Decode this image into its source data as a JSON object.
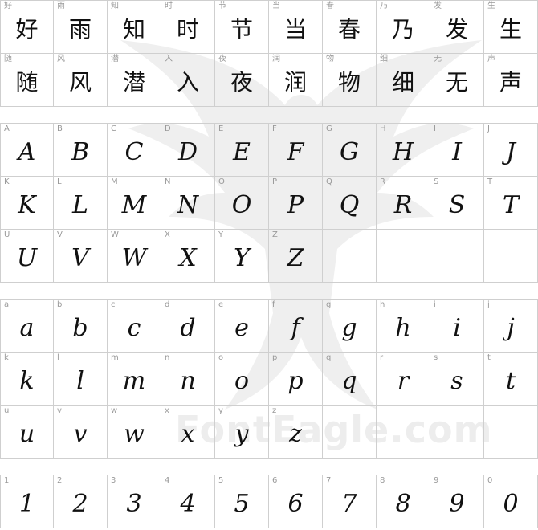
{
  "watermark": {
    "brand": "FontEagle.com",
    "icon": "eagle-watermark-icon"
  },
  "sections": [
    {
      "name": "chinese-samples",
      "cells": [
        {
          "label": "好",
          "glyph": "好"
        },
        {
          "label": "雨",
          "glyph": "雨"
        },
        {
          "label": "知",
          "glyph": "知"
        },
        {
          "label": "时",
          "glyph": "时"
        },
        {
          "label": "节",
          "glyph": "节"
        },
        {
          "label": "当",
          "glyph": "当"
        },
        {
          "label": "春",
          "glyph": "春"
        },
        {
          "label": "乃",
          "glyph": "乃"
        },
        {
          "label": "发",
          "glyph": "发"
        },
        {
          "label": "生",
          "glyph": "生"
        },
        {
          "label": "随",
          "glyph": "随"
        },
        {
          "label": "风",
          "glyph": "风"
        },
        {
          "label": "潜",
          "glyph": "潜"
        },
        {
          "label": "入",
          "glyph": "入"
        },
        {
          "label": "夜",
          "glyph": "夜"
        },
        {
          "label": "润",
          "glyph": "润"
        },
        {
          "label": "物",
          "glyph": "物"
        },
        {
          "label": "细",
          "glyph": "细"
        },
        {
          "label": "无",
          "glyph": "无"
        },
        {
          "label": "声",
          "glyph": "声"
        }
      ]
    },
    {
      "name": "uppercase-samples",
      "cells": [
        {
          "label": "A",
          "glyph": "A"
        },
        {
          "label": "B",
          "glyph": "B"
        },
        {
          "label": "C",
          "glyph": "C"
        },
        {
          "label": "D",
          "glyph": "D"
        },
        {
          "label": "E",
          "glyph": "E"
        },
        {
          "label": "F",
          "glyph": "F"
        },
        {
          "label": "G",
          "glyph": "G"
        },
        {
          "label": "H",
          "glyph": "H"
        },
        {
          "label": "I",
          "glyph": "I"
        },
        {
          "label": "J",
          "glyph": "J"
        },
        {
          "label": "K",
          "glyph": "K"
        },
        {
          "label": "L",
          "glyph": "L"
        },
        {
          "label": "M",
          "glyph": "M"
        },
        {
          "label": "N",
          "glyph": "N"
        },
        {
          "label": "O",
          "glyph": "O"
        },
        {
          "label": "P",
          "glyph": "P"
        },
        {
          "label": "Q",
          "glyph": "Q"
        },
        {
          "label": "R",
          "glyph": "R"
        },
        {
          "label": "S",
          "glyph": "S"
        },
        {
          "label": "T",
          "glyph": "T"
        },
        {
          "label": "U",
          "glyph": "U"
        },
        {
          "label": "V",
          "glyph": "V"
        },
        {
          "label": "W",
          "glyph": "W"
        },
        {
          "label": "X",
          "glyph": "X"
        },
        {
          "label": "Y",
          "glyph": "Y"
        },
        {
          "label": "Z",
          "glyph": "Z"
        },
        {
          "label": "",
          "glyph": ""
        },
        {
          "label": "",
          "glyph": ""
        },
        {
          "label": "",
          "glyph": ""
        },
        {
          "label": "",
          "glyph": ""
        }
      ]
    },
    {
      "name": "lowercase-samples",
      "cells": [
        {
          "label": "a",
          "glyph": "a"
        },
        {
          "label": "b",
          "glyph": "b"
        },
        {
          "label": "c",
          "glyph": "c"
        },
        {
          "label": "d",
          "glyph": "d"
        },
        {
          "label": "e",
          "glyph": "e"
        },
        {
          "label": "f",
          "glyph": "f"
        },
        {
          "label": "g",
          "glyph": "g"
        },
        {
          "label": "h",
          "glyph": "h"
        },
        {
          "label": "i",
          "glyph": "i"
        },
        {
          "label": "j",
          "glyph": "j"
        },
        {
          "label": "k",
          "glyph": "k"
        },
        {
          "label": "l",
          "glyph": "l"
        },
        {
          "label": "m",
          "glyph": "m"
        },
        {
          "label": "n",
          "glyph": "n"
        },
        {
          "label": "o",
          "glyph": "o"
        },
        {
          "label": "p",
          "glyph": "p"
        },
        {
          "label": "q",
          "glyph": "q"
        },
        {
          "label": "r",
          "glyph": "r"
        },
        {
          "label": "s",
          "glyph": "s"
        },
        {
          "label": "t",
          "glyph": "t"
        },
        {
          "label": "u",
          "glyph": "u"
        },
        {
          "label": "v",
          "glyph": "v"
        },
        {
          "label": "w",
          "glyph": "w"
        },
        {
          "label": "x",
          "glyph": "x"
        },
        {
          "label": "y",
          "glyph": "y"
        },
        {
          "label": "z",
          "glyph": "z"
        },
        {
          "label": "",
          "glyph": ""
        },
        {
          "label": "",
          "glyph": ""
        },
        {
          "label": "",
          "glyph": ""
        },
        {
          "label": "",
          "glyph": ""
        }
      ]
    },
    {
      "name": "digit-samples",
      "cells": [
        {
          "label": "1",
          "glyph": "1"
        },
        {
          "label": "2",
          "glyph": "2"
        },
        {
          "label": "3",
          "glyph": "3"
        },
        {
          "label": "4",
          "glyph": "4"
        },
        {
          "label": "5",
          "glyph": "5"
        },
        {
          "label": "6",
          "glyph": "6"
        },
        {
          "label": "7",
          "glyph": "7"
        },
        {
          "label": "8",
          "glyph": "8"
        },
        {
          "label": "9",
          "glyph": "9"
        },
        {
          "label": "0",
          "glyph": "0"
        }
      ]
    }
  ]
}
